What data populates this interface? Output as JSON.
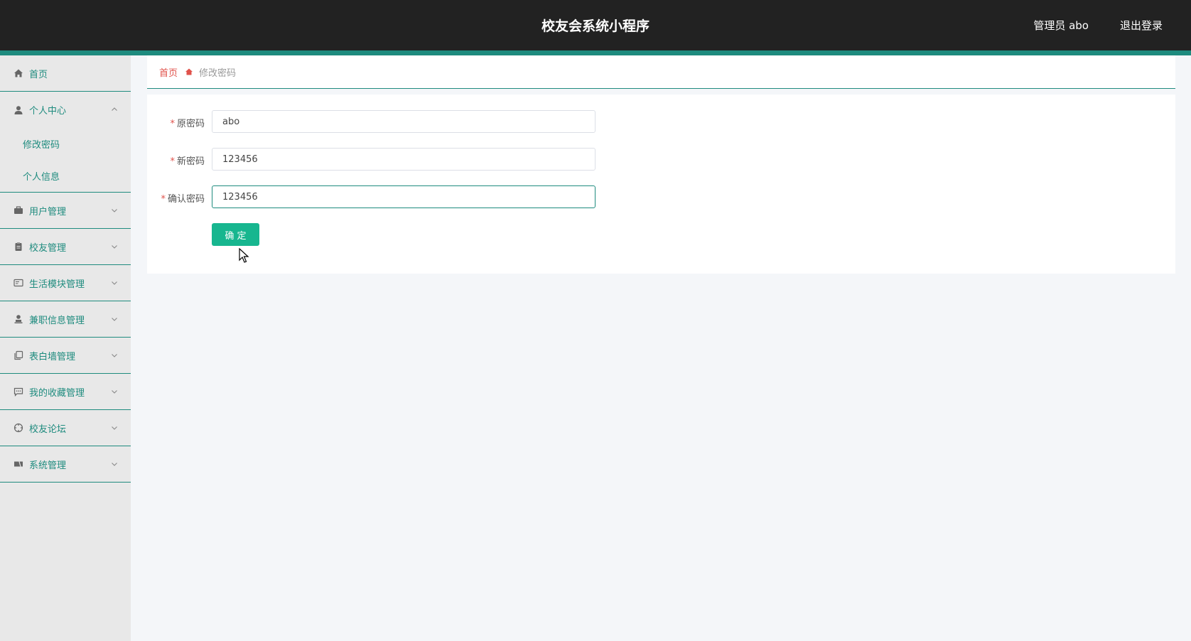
{
  "header": {
    "title": "校友会系统小程序",
    "user": "管理员 abo",
    "logout": "退出登录"
  },
  "sidebar": {
    "home": "首页",
    "personal_center": "个人中心",
    "personal_sub": [
      "修改密码",
      "个人信息"
    ],
    "items": [
      {
        "label": "用户管理",
        "icon": "briefcase-icon"
      },
      {
        "label": "校友管理",
        "icon": "clipboard-icon"
      },
      {
        "label": "生活模块管理",
        "icon": "id-card-icon"
      },
      {
        "label": "兼职信息管理",
        "icon": "user-stamp-icon"
      },
      {
        "label": "表白墙管理",
        "icon": "copy-icon"
      },
      {
        "label": "我的收藏管理",
        "icon": "message-icon"
      },
      {
        "label": "校友论坛",
        "icon": "compass-icon"
      },
      {
        "label": "系统管理",
        "icon": "ticket-icon"
      }
    ]
  },
  "breadcrumb": {
    "home": "首页",
    "current": "修改密码"
  },
  "form": {
    "fields": [
      {
        "label": "原密码",
        "value": "abo"
      },
      {
        "label": "新密码",
        "value": "123456"
      },
      {
        "label": "确认密码",
        "value": "123456"
      }
    ],
    "required_mark": "*",
    "submit": "确 定"
  },
  "colors": {
    "accent": "#1e8b7e",
    "button": "#17b68f",
    "topbar": "#222222",
    "danger": "#e0524b"
  }
}
